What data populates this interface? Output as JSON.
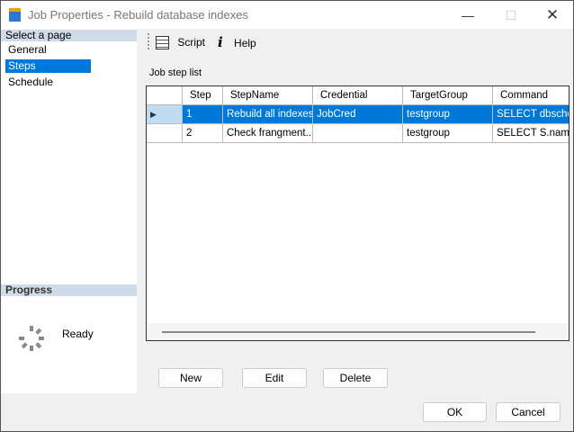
{
  "window": {
    "title": "Job Properties - Rebuild database indexes"
  },
  "sidebar": {
    "header": "Select a page",
    "items": [
      {
        "label": "General"
      },
      {
        "label": "Steps",
        "selected": true
      },
      {
        "label": "Schedule"
      }
    ]
  },
  "progress": {
    "header": "Progress",
    "status": "Ready"
  },
  "toolbar": {
    "script": "Script",
    "help": "Help"
  },
  "main": {
    "list_label": "Job step list",
    "columns": [
      "Step",
      "StepName",
      "Credential",
      "TargetGroup",
      "Command"
    ],
    "rows": [
      {
        "step": "1",
        "name": "Rebuild all indexes",
        "credential": "JobCred",
        "target": "testgroup",
        "command": "SELECT dbsche."
      },
      {
        "step": "2",
        "name": "Check frangment...",
        "credential": "",
        "target": "testgroup",
        "command": "SELECT S.name"
      }
    ]
  },
  "buttons": {
    "new": "New",
    "edit": "Edit",
    "delete": "Delete",
    "ok": "OK",
    "cancel": "Cancel"
  },
  "colors": {
    "selection": "#0078d7",
    "section_header": "#cfdbe8"
  }
}
